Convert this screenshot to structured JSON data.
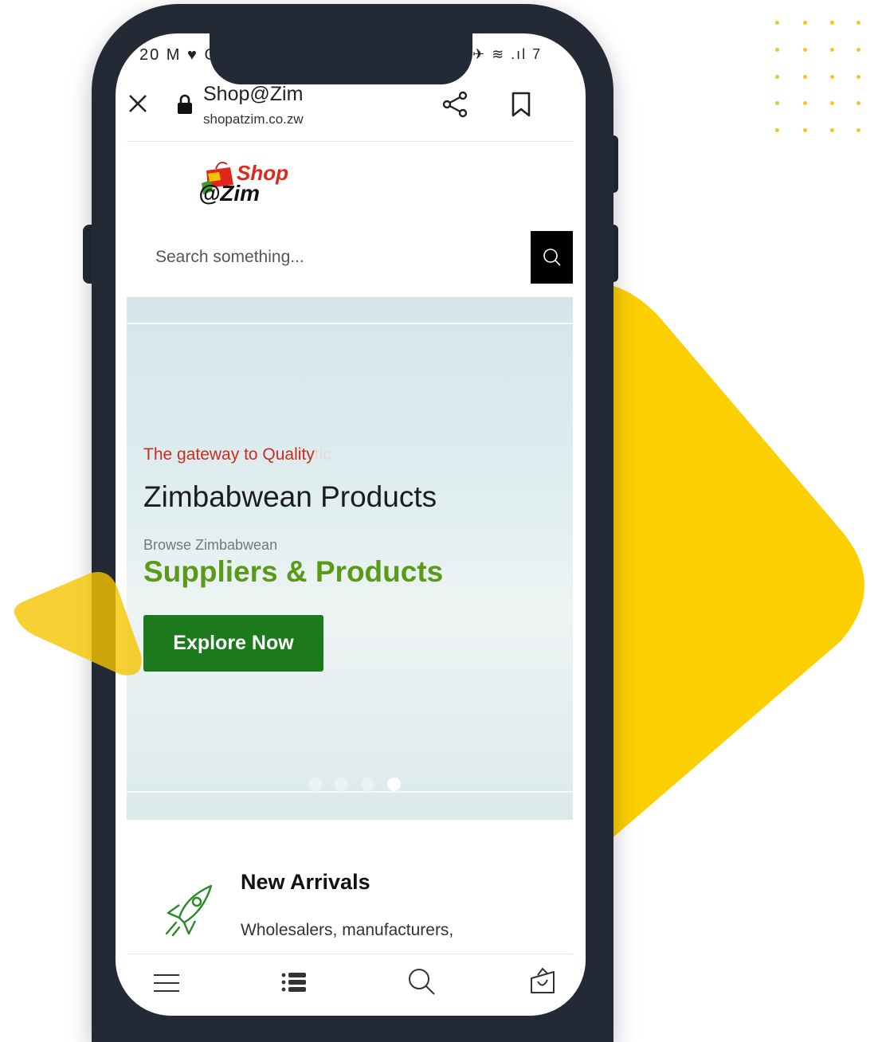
{
  "status_bar": {
    "left_text": "20 M ♥ G",
    "right_text": "✈ ≋ .ıl 7"
  },
  "browser": {
    "site_title": "Shop@Zim",
    "site_url": "shopatzim.co.zw",
    "icons": [
      "close-icon",
      "lock-icon",
      "share-icon",
      "bookmark-icon"
    ]
  },
  "logo": {
    "line1": "Shop",
    "line2": "@Zim"
  },
  "search": {
    "placeholder": "Search something...",
    "icon": "search-icon"
  },
  "hero": {
    "tagline": "The gateway to Quality",
    "tagline_ghost": "tic",
    "title": "Zimbabwean Products",
    "browse_label": "Browse Zimbabwean",
    "suppliers_title": "Suppliers & Products",
    "cta_label": "Explore Now",
    "slide_count": 4,
    "active_slide": 4
  },
  "new_arrivals": {
    "title": "New Arrivals",
    "description": "Wholesalers, manufacturers,",
    "icon": "rocket-icon"
  },
  "bottom_nav": {
    "items": [
      "menu-icon",
      "list-icon",
      "search-icon",
      "basket-icon"
    ]
  },
  "colors": {
    "brand_red": "#cf2a1f",
    "brand_green": "#1c7a1c",
    "headline_green": "#5a9a18",
    "phone_frame": "#232a36",
    "accent_yellow": "#fccf00"
  }
}
